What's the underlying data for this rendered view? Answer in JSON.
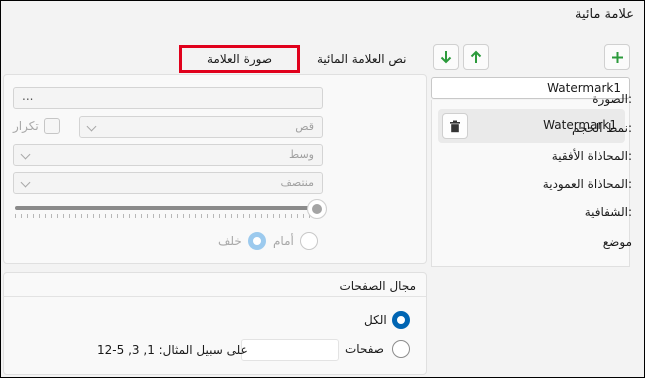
{
  "window": {
    "title": "علامة مائية"
  },
  "toolbar": {
    "add_label": "+",
    "up_label": "↑",
    "down_label": "↓"
  },
  "list": {
    "header": "Watermark1",
    "items": [
      {
        "label": "Watermark1"
      }
    ]
  },
  "tabs": [
    {
      "label": "صورة العلامة المائية",
      "active": true
    },
    {
      "label": "نص العلامة المائية",
      "active": false
    }
  ],
  "image_settings": {
    "image_label": "الصورة:",
    "image_value": "...",
    "size_mode_label": "نمط الحجم:",
    "size_mode_value": "قص",
    "repeat_label": "تكرار",
    "halign_label": "المحاذاة الأفقية:",
    "halign_value": "وسط",
    "valign_label": "المحاذاة العمودية:",
    "valign_value": "منتصف",
    "transparency_label": "الشفافية:",
    "position_label": "موضع",
    "position_front": "أمام",
    "position_behind": "خلف"
  },
  "page_range": {
    "title": "مجال الصفحات",
    "all_label": "الكل",
    "pages_label": "صفحات",
    "example": "على سبيل المثال: 1, 3, 5-12"
  },
  "colors": {
    "accent": "#0065b3",
    "green_icon": "#2b9a3b",
    "highlight": "#e0001b"
  }
}
